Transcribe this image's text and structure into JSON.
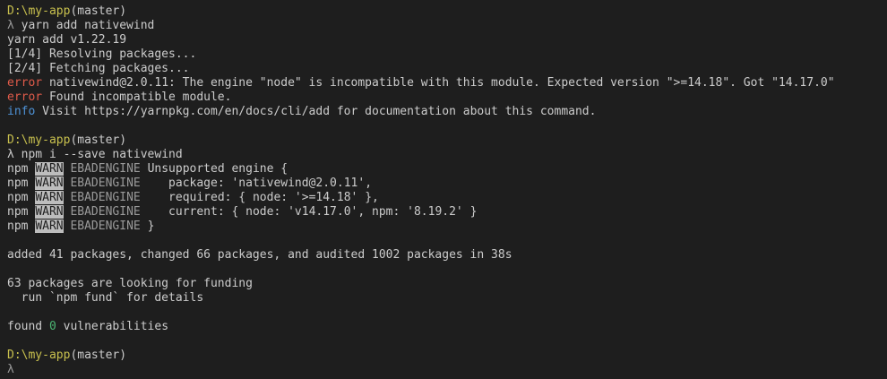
{
  "terminal": {
    "lines": [
      {
        "path": "D:\\my-app",
        "branch_open": "(",
        "branch": "master",
        "branch_close": ")"
      },
      {
        "prompt": "λ",
        "cmd": "yarn add nativewind"
      },
      {
        "text": "yarn add v1.22.19"
      },
      {
        "text": "[1/4] Resolving packages..."
      },
      {
        "text": "[2/4] Fetching packages..."
      },
      {
        "level": "error",
        "text": "nativewind@2.0.11: The engine \"node\" is incompatible with this module. Expected version \">=14.18\". Got \"14.17.0\""
      },
      {
        "level": "error",
        "text": "Found incompatible module."
      },
      {
        "level": "info",
        "text": "Visit https://yarnpkg.com/en/docs/cli/add for documentation about this command."
      },
      {
        "path": "D:\\my-app",
        "branch_open": "(",
        "branch": "master",
        "branch_close": ")"
      },
      {
        "prompt": "λ",
        "cmd": "npm i --save nativewind"
      },
      {
        "npm": "npm",
        "warn": "WARN",
        "code": "EBADENGINE",
        "text": "Unsupported engine {"
      },
      {
        "npm": "npm",
        "warn": "WARN",
        "code": "EBADENGINE",
        "text": "  package: 'nativewind@2.0.11',"
      },
      {
        "npm": "npm",
        "warn": "WARN",
        "code": "EBADENGINE",
        "text": "  required: { node: '>=14.18' },"
      },
      {
        "npm": "npm",
        "warn": "WARN",
        "code": "EBADENGINE",
        "text": "  current: { node: 'v14.17.0', npm: '8.19.2' }"
      },
      {
        "npm": "npm",
        "warn": "WARN",
        "code": "EBADENGINE",
        "text": "}"
      },
      {
        "text": "added 41 packages, changed 66 packages, and audited 1002 packages in 38s"
      },
      {
        "text": "63 packages are looking for funding"
      },
      {
        "text": "  run `npm fund` for details"
      },
      {
        "pre": "found ",
        "count": "0",
        "post": " vulnerabilities"
      },
      {
        "path": "D:\\my-app",
        "branch_open": "(",
        "branch": "master",
        "branch_close": ")"
      },
      {
        "prompt": "λ"
      }
    ]
  },
  "colors": {
    "background": "#1e1e1e",
    "text": "#cccccc",
    "path": "#c8c04e",
    "error": "#e05b4a",
    "info": "#4e92d6",
    "success": "#4cb573",
    "warn_badge": "#bdbdbd"
  }
}
